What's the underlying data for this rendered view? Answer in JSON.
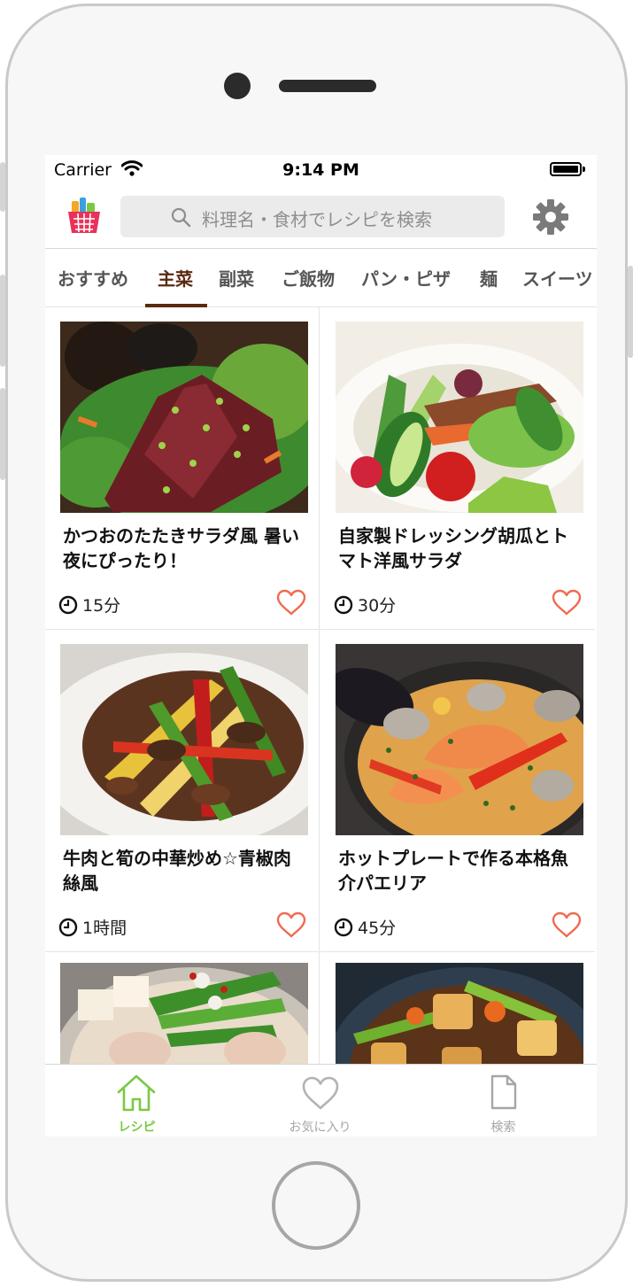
{
  "status_bar": {
    "carrier": "Carrier",
    "time": "9:14 PM"
  },
  "header": {
    "logo": "shopping-basket-icon",
    "search_placeholder": "料理名・食材でレシピを検索",
    "settings": "gear-icon"
  },
  "tabs": [
    {
      "label": "おすすめ",
      "active": false
    },
    {
      "label": "主菜",
      "active": true
    },
    {
      "label": "副菜",
      "active": false
    },
    {
      "label": "ご飯物",
      "active": false
    },
    {
      "label": "パン・ピザ",
      "active": false
    },
    {
      "label": "麺",
      "active": false
    },
    {
      "label": "スイーツ",
      "active": false
    }
  ],
  "recipes": [
    {
      "title": "かつおのたたきサラダ風 暑い夜にぴったり！",
      "time": "15分",
      "favorite": false
    },
    {
      "title": "自家製ドレッシング胡瓜とトマト洋風サラダ",
      "time": "30分",
      "favorite": false
    },
    {
      "title": "牛肉と筍の中華炒め☆青椒肉絲風",
      "time": "1時間",
      "favorite": false
    },
    {
      "title": "ホットプレートで作る本格魚介パエリア",
      "time": "45分",
      "favorite": false
    },
    {
      "title": "",
      "time": "",
      "favorite": false
    },
    {
      "title": "",
      "time": "",
      "favorite": false
    }
  ],
  "tab_bar": [
    {
      "label": "レシピ",
      "icon": "home-icon",
      "active": true
    },
    {
      "label": "お気に入り",
      "icon": "heart-icon",
      "active": false
    },
    {
      "label": "検索",
      "icon": "document-icon",
      "active": false
    }
  ],
  "colors": {
    "accent": "#7ac943",
    "tab_active": "#5a2a12",
    "heart": "#f06a4f"
  }
}
